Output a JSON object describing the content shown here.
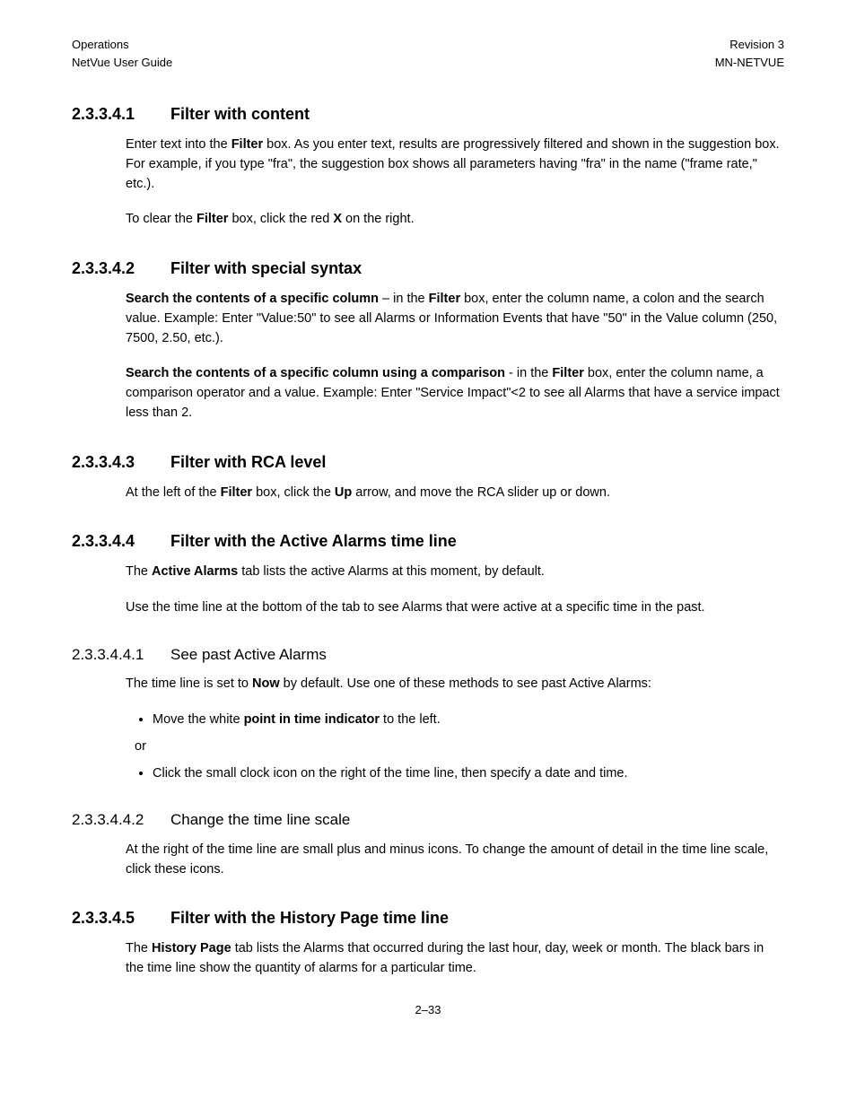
{
  "header": {
    "left1": "Operations",
    "left2": "NetVue User Guide",
    "right1": "Revision 3",
    "right2": "MN-NETVUE"
  },
  "sections": {
    "s1": {
      "num": "2.3.3.4.1",
      "title": "Filter with content",
      "p1a": "Enter text into the ",
      "p1b": "Filter",
      "p1c": " box. As you enter text, results are progressively filtered and shown in the suggestion box. For example, if you type \"fra\", the suggestion box shows all parameters having \"fra\" in the name (\"frame rate,\" etc.).",
      "p2a": "To clear the ",
      "p2b": "Filter",
      "p2c": " box, click the red ",
      "p2d": "X",
      "p2e": " on the right."
    },
    "s2": {
      "num": "2.3.3.4.2",
      "title": "Filter with special syntax",
      "p1a": "Search the contents of a specific column",
      "p1b": " – in the ",
      "p1c": "Filter",
      "p1d": " box, enter the column name, a colon and the search value. Example:  Enter \"Value:50\" to see all Alarms or Information Events that have \"50\" in the Value column (250, 7500, 2.50, etc.).",
      "p2a": "Search the contents of a specific column using a comparison",
      "p2b": " - in the ",
      "p2c": "Filter",
      "p2d": " box, enter the column name, a comparison operator and a value. Example:  Enter \"Service Impact\"<2 to see all Alarms that have a service impact less than 2."
    },
    "s3": {
      "num": "2.3.3.4.3",
      "title": "Filter with RCA level",
      "p1a": "At the left of the ",
      "p1b": "Filter",
      "p1c": " box, click the ",
      "p1d": "Up",
      "p1e": " arrow, and move the RCA slider up or down."
    },
    "s4": {
      "num": "2.3.3.4.4",
      "title": "Filter with the Active Alarms time line",
      "p1a": "The ",
      "p1b": "Active Alarms",
      "p1c": " tab lists the active Alarms at this moment, by default.",
      "p2": "Use the time line at the bottom of the tab to see Alarms that were active at a specific time in the past."
    },
    "s4_1": {
      "num": "2.3.3.4.4.1",
      "title": "See past Active Alarms",
      "p1a": "The time line is set to ",
      "p1b": "Now",
      "p1c": " by default. Use one of these methods to see past Active Alarms:",
      "li1a": "Move the white ",
      "li1b": "point in time indicator",
      "li1c": " to the left.",
      "or": "or",
      "li2": "Click the small clock icon on the right of the time line, then specify a date and time."
    },
    "s4_2": {
      "num": "2.3.3.4.4.2",
      "title": "Change the time line scale",
      "p1": "At the right of the time line are small plus and minus icons. To change the amount of detail in the time line scale, click these icons."
    },
    "s5": {
      "num": "2.3.3.4.5",
      "title": "Filter with the History Page time line",
      "p1a": "The ",
      "p1b": "History Page",
      "p1c": " tab lists the Alarms that occurred during the last hour, day, week or month. The black bars in the time line show the quantity of alarms for a particular time."
    }
  },
  "footer": {
    "page": "2–33"
  }
}
